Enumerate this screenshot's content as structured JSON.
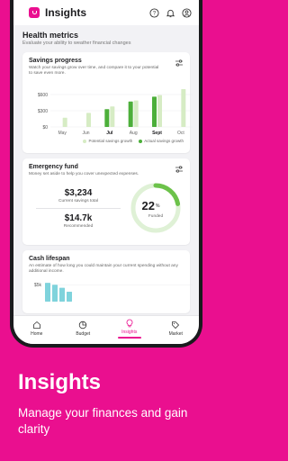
{
  "header": {
    "title": "Insights"
  },
  "health": {
    "title": "Health metrics",
    "subtitle": "Evaluate your ability to weather financial changes"
  },
  "savings": {
    "title": "Savings progress",
    "desc": "Watch your savings grow over time, and compare it to your potential to save even more.",
    "legend_potential": "Potential savings growth",
    "legend_actual": "Actual savings growth"
  },
  "chart_data": {
    "type": "bar",
    "categories": [
      "May",
      "Jun",
      "Jul",
      "Aug",
      "Sept",
      "Oct"
    ],
    "yticks": [
      "$600",
      "$300",
      "$0"
    ],
    "ylim": [
      0,
      800
    ],
    "series": [
      {
        "name": "Potential savings growth",
        "values": [
          170,
          260,
          380,
          490,
          590,
          700
        ],
        "color": "#d6ecc4"
      },
      {
        "name": "Actual savings growth",
        "values": [
          0,
          0,
          330,
          470,
          560,
          0
        ],
        "color": "#4caf3a"
      }
    ],
    "bold_categories": [
      "Jul",
      "Sept"
    ]
  },
  "emergency": {
    "title": "Emergency fund",
    "desc": "Money set aside to help you cover unexpected expenses.",
    "current_value": "$3,234",
    "current_label": "Current savings total",
    "recommended_value": "$14.7k",
    "recommended_label": "Recommended",
    "percent": 22,
    "percent_text": "22",
    "percent_sign": "%",
    "funded_label": "Funded",
    "ring_color": "#6cc24a",
    "track_color": "#dff1d6"
  },
  "cash": {
    "title": "Cash lifespan",
    "desc": "An estimate of how long you could maintain your current spending without any additional income.",
    "ytick": "$5k",
    "bars": [
      0.95,
      0.85,
      0.7,
      0.5
    ],
    "bar_color": "#7fd3dc"
  },
  "nav": {
    "items": [
      {
        "label": "Home"
      },
      {
        "label": "Budget"
      },
      {
        "label": "Insights"
      },
      {
        "label": "Market"
      }
    ]
  },
  "promo": {
    "title": "Insights",
    "subtitle": "Manage your finances and gain clarity"
  },
  "colors": {
    "brand": "#ea0f8f"
  }
}
